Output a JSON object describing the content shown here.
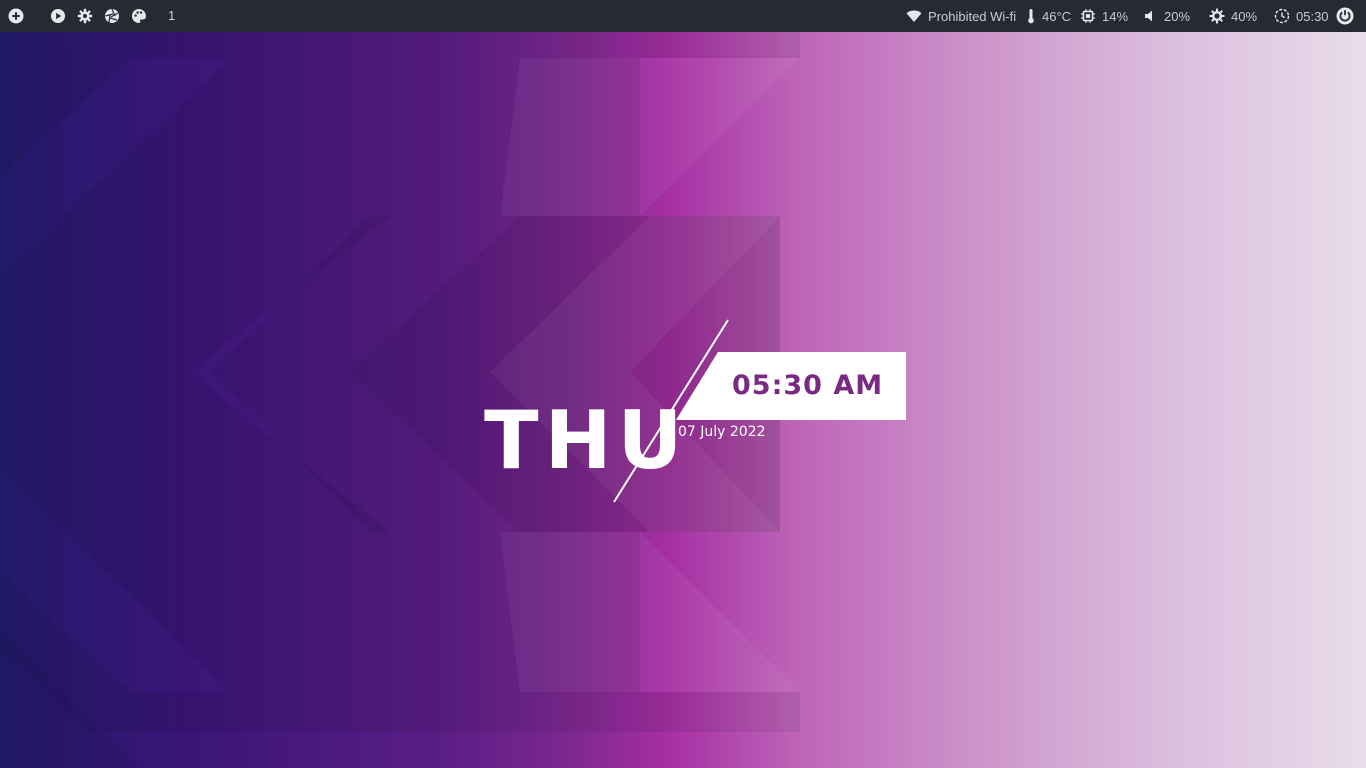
{
  "topbar": {
    "left": {
      "launcher_icon": "plus-circle-icon",
      "play_icon": "play-circle-icon",
      "settings_icon": "gear-icon",
      "aperture_icon": "aperture-icon",
      "palette_icon": "palette-icon",
      "workspace": "1"
    },
    "right": {
      "wifi": {
        "icon": "wifi-icon",
        "label": "Prohibited Wi-fi"
      },
      "temperature": {
        "icon": "thermometer-icon",
        "label": "46°C"
      },
      "cpu": {
        "icon": "cpu-chip-icon",
        "label": "14%"
      },
      "volume": {
        "icon": "speaker-icon",
        "label": "20%"
      },
      "brightness": {
        "icon": "brightness-icon",
        "label": "40%"
      },
      "clock": {
        "icon": "clock-icon",
        "label": "05:30"
      },
      "power_icon": "power-icon"
    }
  },
  "desktop": {
    "clock_widget": {
      "day": "THU",
      "time": "05:30 AM",
      "date": "07 July 2022"
    }
  },
  "colors": {
    "bar_bg": "#272a33",
    "bar_text": "#c9ccd3",
    "time_text": "#7b2a84",
    "time_box": "#ffffff"
  }
}
